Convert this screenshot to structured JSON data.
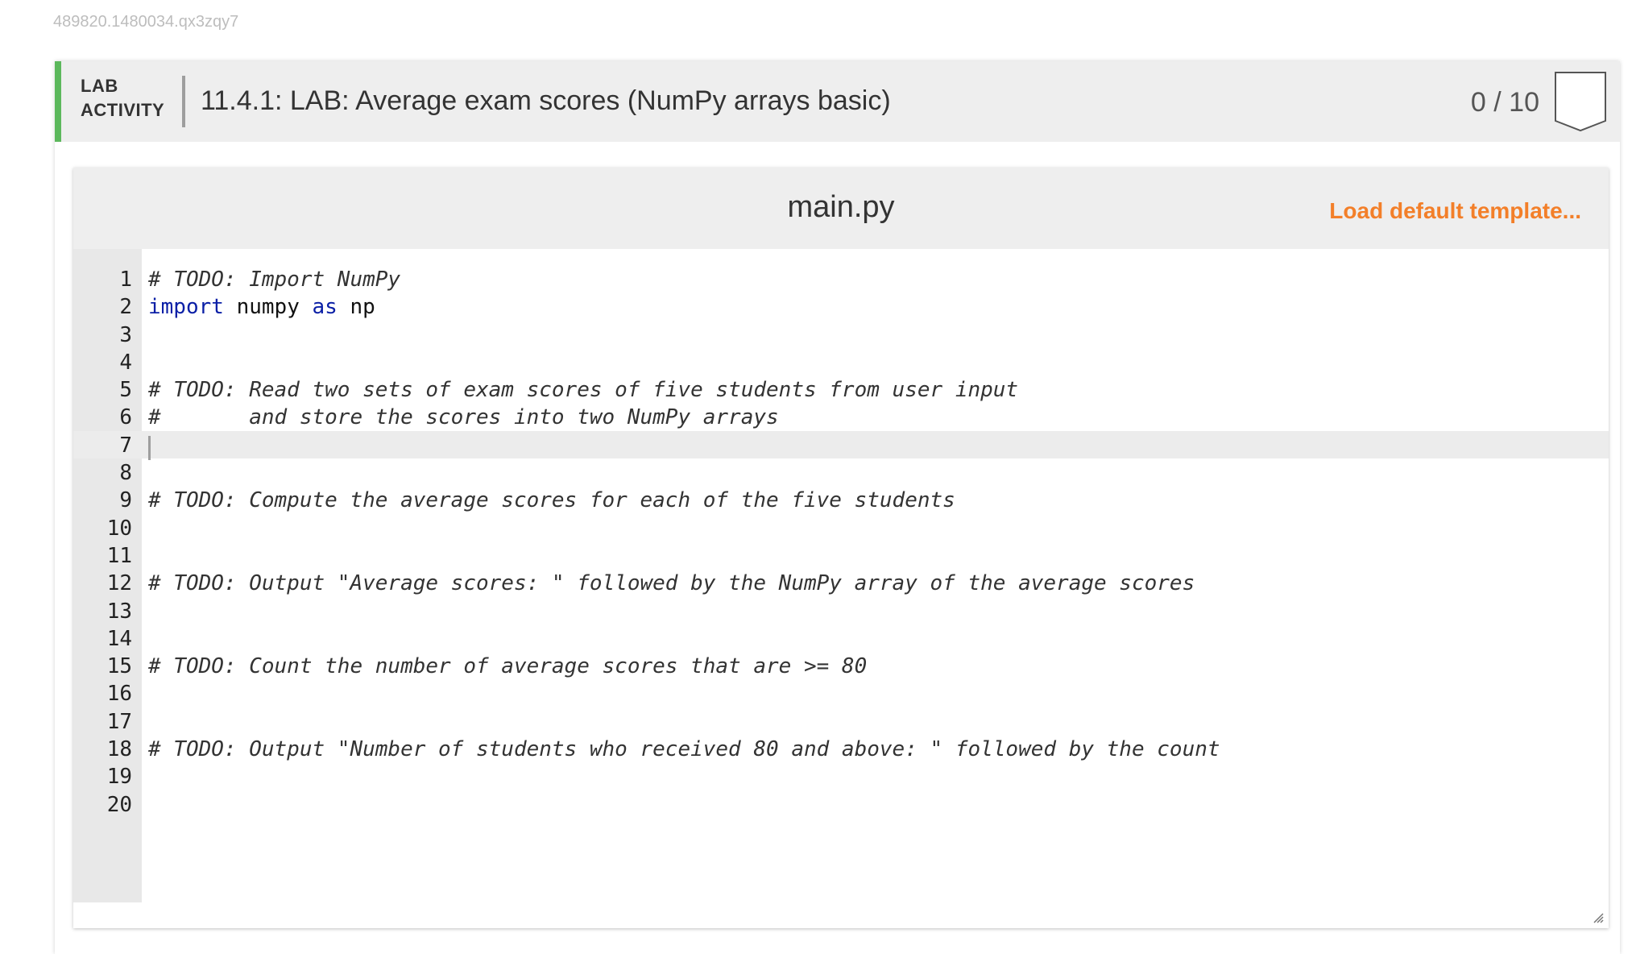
{
  "page": {
    "id_text": "489820.1480034.qx3zqy7"
  },
  "activity": {
    "type_line1": "LAB",
    "type_line2": "ACTIVITY",
    "title": "11.4.1: LAB: Average exam scores (NumPy arrays basic)",
    "score": "0 / 10",
    "accent_color": "#5cb85c"
  },
  "editor": {
    "file_name": "main.py",
    "load_template_label": "Load default template...",
    "load_template_color": "#f37f29",
    "active_line": 7,
    "lines": [
      {
        "num": "1",
        "code": "# TODO: Import NumPy",
        "kind": "comment"
      },
      {
        "num": "2",
        "code": "import numpy as np",
        "kind": "import"
      },
      {
        "num": "3",
        "code": "",
        "kind": "blank"
      },
      {
        "num": "4",
        "code": "",
        "kind": "blank"
      },
      {
        "num": "5",
        "code": "# TODO: Read two sets of exam scores of five students from user input",
        "kind": "comment"
      },
      {
        "num": "6",
        "code": "#       and store the scores into two NumPy arrays",
        "kind": "comment"
      },
      {
        "num": "7",
        "code": "",
        "kind": "blank"
      },
      {
        "num": "8",
        "code": "",
        "kind": "blank"
      },
      {
        "num": "9",
        "code": "# TODO: Compute the average scores for each of the five students",
        "kind": "comment"
      },
      {
        "num": "10",
        "code": "",
        "kind": "blank"
      },
      {
        "num": "11",
        "code": "",
        "kind": "blank"
      },
      {
        "num": "12",
        "code": "# TODO: Output \"Average scores: \" followed by the NumPy array of the average scores",
        "kind": "comment"
      },
      {
        "num": "13",
        "code": "",
        "kind": "blank"
      },
      {
        "num": "14",
        "code": "",
        "kind": "blank"
      },
      {
        "num": "15",
        "code": "# TODO: Count the number of average scores that are >= 80",
        "kind": "comment"
      },
      {
        "num": "16",
        "code": "",
        "kind": "blank"
      },
      {
        "num": "17",
        "code": "",
        "kind": "blank"
      },
      {
        "num": "18",
        "code": "# TODO: Output \"Number of students who received 80 and above: \" followed by the count",
        "kind": "comment"
      },
      {
        "num": "19",
        "code": "",
        "kind": "blank"
      },
      {
        "num": "20",
        "code": "",
        "kind": "blank"
      }
    ],
    "import_tokens": {
      "kw1": "import",
      "mod": " numpy ",
      "kw2": "as",
      "alias": " np"
    }
  },
  "icons": {
    "score_icon": "shield-outline-icon",
    "resize_icon": "resize-handle-icon"
  }
}
